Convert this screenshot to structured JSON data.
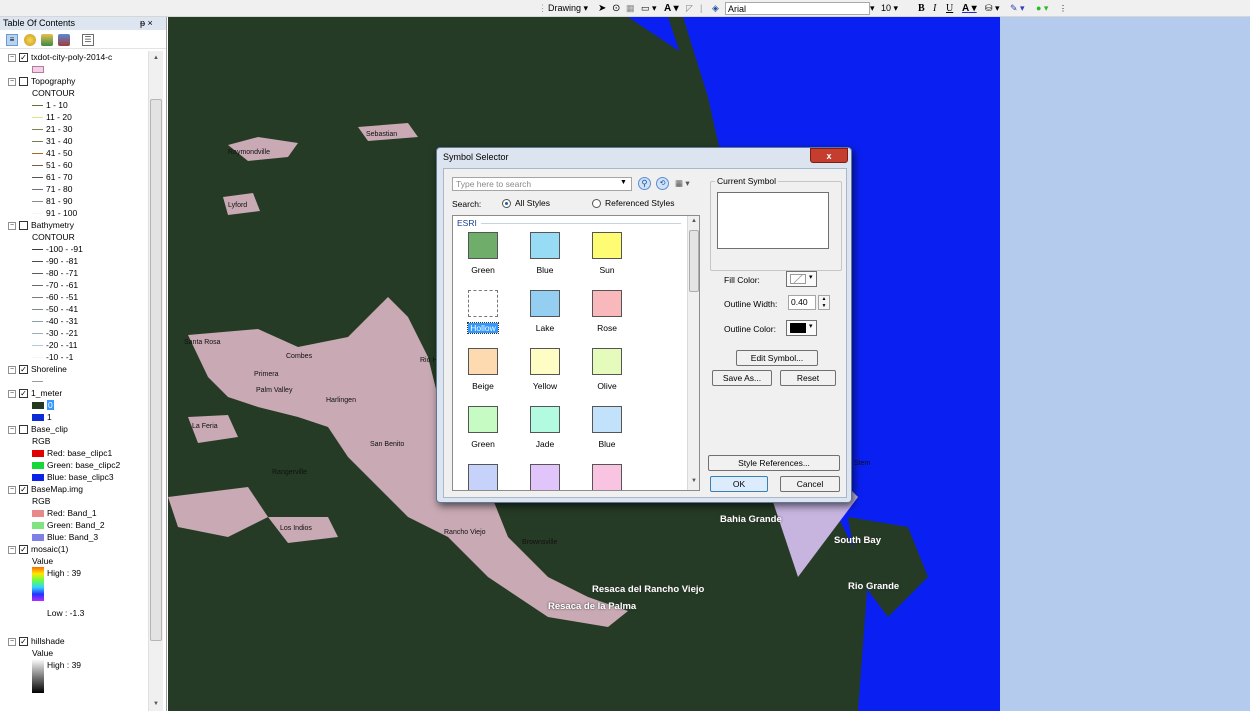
{
  "toolbar": {
    "drawing_label": "Drawing",
    "font_name": "Arial",
    "font_size": "10",
    "bold": "B",
    "italic": "I",
    "underline": "U",
    "font_color_letter": "A"
  },
  "toc": {
    "title": "Table Of Contents",
    "pin": "ᵽ ×",
    "rows": [
      {
        "type": "layer",
        "label": "txdot-city-poly-2014-c",
        "checked": true
      },
      {
        "type": "swatch",
        "label": "",
        "color": "#f5cfe6"
      },
      {
        "type": "layer",
        "label": "Topography",
        "checked": false
      },
      {
        "type": "field",
        "label": "CONTOUR"
      },
      {
        "type": "line",
        "label": "1 - 10",
        "color": "#6b6b3b"
      },
      {
        "type": "line",
        "label": "11 - 20",
        "color": "#d8e68a"
      },
      {
        "type": "line",
        "label": "21 - 30",
        "color": "#7f7f4f"
      },
      {
        "type": "line",
        "label": "31 - 40",
        "color": "#7a7a55"
      },
      {
        "type": "line",
        "label": "41 - 50",
        "color": "#a56a2a"
      },
      {
        "type": "line",
        "label": "51 - 60",
        "color": "#7b5a4a"
      },
      {
        "type": "line",
        "label": "61 - 70",
        "color": "#555555"
      },
      {
        "type": "line",
        "label": "71 - 80",
        "color": "#7a6a8a"
      },
      {
        "type": "line",
        "label": "81 - 90",
        "color": "#8a8a8a"
      },
      {
        "type": "line",
        "label": "91 - 100",
        "color": "#ffffff"
      },
      {
        "type": "layer",
        "label": "Bathymetry",
        "checked": false
      },
      {
        "type": "field",
        "label": "CONTOUR"
      },
      {
        "type": "line",
        "label": "-100 - -91",
        "color": "#3a3a3a"
      },
      {
        "type": "line",
        "label": "-90 - -81",
        "color": "#4a4a4a"
      },
      {
        "type": "line",
        "label": "-80 - -71",
        "color": "#5a5a5a"
      },
      {
        "type": "line",
        "label": "-70 - -61",
        "color": "#6a6a6a"
      },
      {
        "type": "line",
        "label": "-60 - -51",
        "color": "#7a7a7a"
      },
      {
        "type": "line",
        "label": "-50 - -41",
        "color": "#7b8a90"
      },
      {
        "type": "line",
        "label": "-40 - -31",
        "color": "#8aa0a8"
      },
      {
        "type": "line",
        "label": "-30 - -21",
        "color": "#9ab0b8"
      },
      {
        "type": "line",
        "label": "-20 - -11",
        "color": "#a8d0d8"
      },
      {
        "type": "line",
        "label": "-10 - -1",
        "color": "#ffffff"
      },
      {
        "type": "layer",
        "label": "Shoreline",
        "checked": true
      },
      {
        "type": "line",
        "label": "",
        "color": "#9a9a9a"
      },
      {
        "type": "layer",
        "label": "1_meter",
        "checked": true
      },
      {
        "type": "swatch",
        "label": "0",
        "color": "#223a22",
        "selected": true
      },
      {
        "type": "swatch",
        "label": "1",
        "color": "#0a2bd6"
      },
      {
        "type": "layer",
        "label": "Base_clip",
        "checked": false
      },
      {
        "type": "field",
        "label": "RGB"
      },
      {
        "type": "swatch",
        "label": "Red:   base_clipc1",
        "color": "#e00000"
      },
      {
        "type": "swatch",
        "label": "Green: base_clipc2",
        "color": "#16d63a"
      },
      {
        "type": "swatch",
        "label": "Blue:  base_clipc3",
        "color": "#0a23e6"
      },
      {
        "type": "layer",
        "label": "BaseMap.img",
        "checked": true
      },
      {
        "type": "field",
        "label": "RGB"
      },
      {
        "type": "swatch",
        "label": "Red:   Band_1",
        "color": "#e88888"
      },
      {
        "type": "swatch",
        "label": "Green: Band_2",
        "color": "#7fe37f"
      },
      {
        "type": "swatch",
        "label": "Blue:  Band_3",
        "color": "#7f7fe8"
      },
      {
        "type": "layer",
        "label": "mosaic(1)",
        "checked": true
      },
      {
        "type": "field",
        "label": "Value"
      },
      {
        "type": "ramp",
        "label": "High : 39"
      },
      {
        "type": "rampend",
        "label": "Low : -1.3"
      },
      {
        "type": "gap",
        "label": ""
      },
      {
        "type": "layer",
        "label": "hillshade",
        "checked": true
      },
      {
        "type": "field",
        "label": "Value"
      },
      {
        "type": "grey",
        "label": "High : 39"
      }
    ]
  },
  "map": {
    "labels": [
      "Sebastian",
      "Raymondville",
      "Lyford",
      "Santa Rosa",
      "Combes",
      "Primera",
      "Palm Valley",
      "Harlingen",
      "Rio Hondo",
      "La Feria",
      "San Benito",
      "Rangerville",
      "Los Indios",
      "Rancho Viejo",
      "Brownsville"
    ],
    "bold_labels": [
      "Bahia Grande",
      "South Bay",
      "Rio Grande",
      "Resaca del Rancho Viejo",
      "Resaca de la Palma"
    ],
    "partial_label": "Stem"
  },
  "dialog": {
    "title": "Symbol Selector",
    "close": "x",
    "search_placeholder": "Type here to search",
    "search_label": "Search:",
    "all_styles": "All Styles",
    "referenced_styles": "Referenced Styles",
    "group": "ESRI",
    "symbols": [
      {
        "name": "Green",
        "color": "#6fae6a"
      },
      {
        "name": "Blue",
        "color": "#97dbf5"
      },
      {
        "name": "Sun",
        "color": "#fdfc73"
      },
      {
        "name": "Hollow",
        "color": "#ffffff",
        "selected": true
      },
      {
        "name": "Lake",
        "color": "#94cff2"
      },
      {
        "name": "Rose",
        "color": "#f8b8bc"
      },
      {
        "name": "Beige",
        "color": "#fddab0"
      },
      {
        "name": "Yellow",
        "color": "#fefdc4"
      },
      {
        "name": "Olive",
        "color": "#e4fbbc"
      },
      {
        "name": "Green",
        "color": "#c6fbc4"
      },
      {
        "name": "Jade",
        "color": "#b2fbe1"
      },
      {
        "name": "Blue",
        "color": "#c2e1fa"
      },
      {
        "name": "",
        "color": "#c6d2fa"
      },
      {
        "name": "",
        "color": "#e1c4fa"
      },
      {
        "name": "",
        "color": "#f9c4e2"
      }
    ],
    "current_symbol": "Current Symbol",
    "fill_color": "Fill Color:",
    "outline_width": "Outline Width:",
    "outline_width_value": "0.40",
    "outline_color": "Outline Color:",
    "edit_symbol": "Edit Symbol...",
    "save_as": "Save As...",
    "reset": "Reset",
    "style_references": "Style References...",
    "ok": "OK",
    "cancel": "Cancel"
  }
}
